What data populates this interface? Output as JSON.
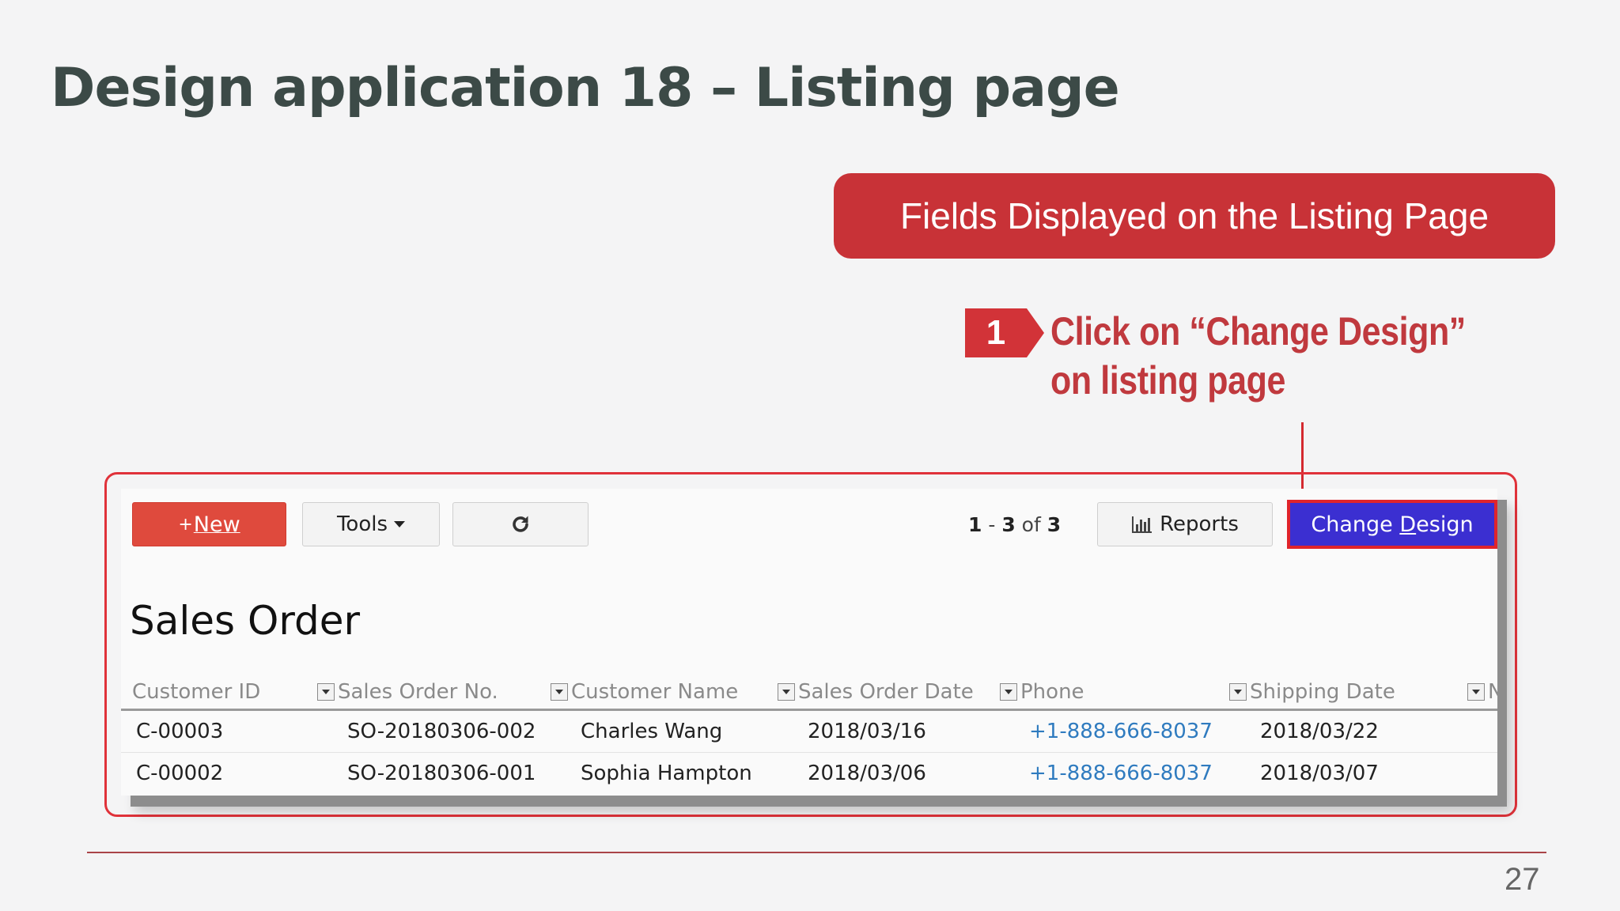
{
  "slide": {
    "title": "Design application 18 – Listing page",
    "banner": "Fields Displayed on the Listing Page",
    "step_number": "1",
    "step_text": "Click on “Change Design” on listing page",
    "page_number": "27"
  },
  "toolbar": {
    "new_plus": "+",
    "new_label": "New",
    "tools_label": "Tools",
    "refresh_icon": "refresh-icon",
    "pager_start": "1",
    "pager_sep": " - ",
    "pager_end": "3",
    "pager_of": " of ",
    "pager_total": "3",
    "reports_label": "Reports",
    "change_design_pre": "Change ",
    "change_design_u": "D",
    "change_design_post": "esign"
  },
  "page_heading": "Sales Order",
  "table": {
    "columns": [
      "Customer ID",
      "Sales Order No.",
      "Customer Name",
      "Sales Order Date",
      "Phone",
      "Shipping Date",
      "N"
    ],
    "rows": [
      [
        "C-00003",
        "SO-20180306-002",
        "Charles Wang",
        "2018/03/16",
        "+1-888-666-8037",
        "2018/03/22"
      ],
      [
        "C-00002",
        "SO-20180306-001",
        "Sophia Hampton",
        "2018/03/06",
        "+1-888-666-8037",
        "2018/03/07"
      ]
    ]
  },
  "colors": {
    "title": "#3c4a47",
    "banner": "#c83237",
    "step_text": "#c0393e",
    "new_button": "#df4a3d",
    "change_design_button": "#3b2fd1",
    "highlight_border": "#e0242c",
    "phone_link": "#2f7bbf"
  }
}
